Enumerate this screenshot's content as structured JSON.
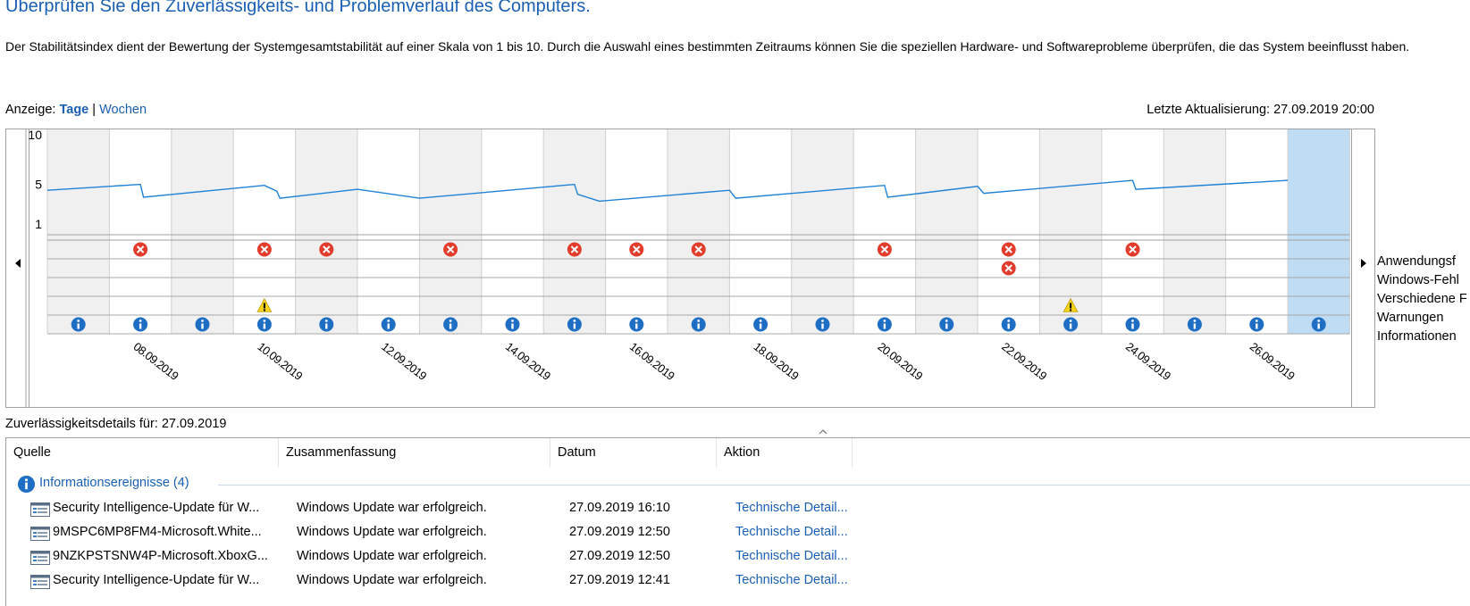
{
  "page": {
    "title": "Überprüfen Sie den Zuverlässigkeits- und Problemverlauf des Computers.",
    "description": "Der Stabilitätsindex dient der Bewertung der Systemgesamtstabilität auf einer Skala von 1 bis 10. Durch die Auswahl eines bestimmten Zeitraums können Sie die speziellen Hardware- und Softwareprobleme überprüfen, die das System beeinflusst haben."
  },
  "view": {
    "label": "Anzeige:",
    "days": "Tage",
    "separator": "|",
    "weeks": "Wochen"
  },
  "last_update": "Letzte Aktualisierung: 27.09.2019 20:00",
  "chart_data": {
    "type": "line",
    "dates": [
      "07.09.2019",
      "08.09.2019",
      "09.09.2019",
      "10.09.2019",
      "11.09.2019",
      "12.09.2019",
      "13.09.2019",
      "14.09.2019",
      "15.09.2019",
      "16.09.2019",
      "17.09.2019",
      "18.09.2019",
      "19.09.2019",
      "20.09.2019",
      "21.09.2019",
      "22.09.2019",
      "23.09.2019",
      "24.09.2019",
      "25.09.2019",
      "26.09.2019",
      "27.09.2019"
    ],
    "x_tick_labels": [
      "08.09.2019",
      "10.09.2019",
      "12.09.2019",
      "14.09.2019",
      "16.09.2019",
      "18.09.2019",
      "20.09.2019",
      "22.09.2019",
      "24.09.2019",
      "26.09.2019"
    ],
    "y_ticks": [
      10,
      5,
      1
    ],
    "ylim": [
      1,
      10
    ],
    "stability_index": [
      [
        0.0,
        4.4
      ],
      [
        1.5,
        5.0
      ],
      [
        1.55,
        3.7
      ],
      [
        3.5,
        4.9
      ],
      [
        3.7,
        4.3
      ],
      [
        3.75,
        3.6
      ],
      [
        5.0,
        4.5
      ],
      [
        6.0,
        3.6
      ],
      [
        8.5,
        5.0
      ],
      [
        8.55,
        4.0
      ],
      [
        8.9,
        3.3
      ],
      [
        11.0,
        4.4
      ],
      [
        11.1,
        3.6
      ],
      [
        13.5,
        4.9
      ],
      [
        13.55,
        3.7
      ],
      [
        15.0,
        4.8
      ],
      [
        15.1,
        4.1
      ],
      [
        17.5,
        5.4
      ],
      [
        17.55,
        4.5
      ],
      [
        20.0,
        5.4
      ]
    ],
    "selected_date": "27.09.2019",
    "rows": [
      "Anwendungsf",
      "Windows-Fehl",
      "Verschiedene F",
      "Warnungen",
      "Informationen"
    ],
    "events": {
      "application_failures": [
        "08.09.2019",
        "10.09.2019",
        "11.09.2019",
        "13.09.2019",
        "15.09.2019",
        "16.09.2019",
        "17.09.2019",
        "20.09.2019",
        "22.09.2019",
        "24.09.2019"
      ],
      "windows_failures": [
        "22.09.2019"
      ],
      "misc_failures": [],
      "warnings": [
        "10.09.2019",
        "23.09.2019"
      ],
      "information": [
        "07.09.2019",
        "08.09.2019",
        "09.09.2019",
        "10.09.2019",
        "11.09.2019",
        "12.09.2019",
        "13.09.2019",
        "14.09.2019",
        "15.09.2019",
        "16.09.2019",
        "17.09.2019",
        "18.09.2019",
        "19.09.2019",
        "20.09.2019",
        "21.09.2019",
        "22.09.2019",
        "23.09.2019",
        "24.09.2019",
        "25.09.2019",
        "26.09.2019",
        "27.09.2019"
      ]
    },
    "colors": {
      "line": "#1f82d6",
      "column_shaded": "#f0f0f0",
      "selected": "#bfdcf5",
      "error": "#e23c2c",
      "warning": "#f6d21a",
      "info": "#1e6fc4"
    }
  },
  "details": {
    "title": "Zuverlässigkeitsdetails für: 27.09.2019",
    "columns": {
      "source": "Quelle",
      "summary": "Zusammenfassung",
      "date": "Datum",
      "action": "Aktion"
    },
    "group": "Informationsereignisse (4)",
    "rows": [
      {
        "source": "Security Intelligence-Update für W...",
        "summary": "Windows Update war erfolgreich.",
        "date": "27.09.2019 16:10",
        "action": "Technische Detail..."
      },
      {
        "source": "9MSPC6MP8FM4-Microsoft.White...",
        "summary": "Windows Update war erfolgreich.",
        "date": "27.09.2019 12:50",
        "action": "Technische Detail..."
      },
      {
        "source": "9NZKPSTSNW4P-Microsoft.XboxG...",
        "summary": "Windows Update war erfolgreich.",
        "date": "27.09.2019 12:50",
        "action": "Technische Detail..."
      },
      {
        "source": "Security Intelligence-Update für W...",
        "summary": "Windows Update war erfolgreich.",
        "date": "27.09.2019 12:41",
        "action": "Technische Detail..."
      }
    ]
  }
}
